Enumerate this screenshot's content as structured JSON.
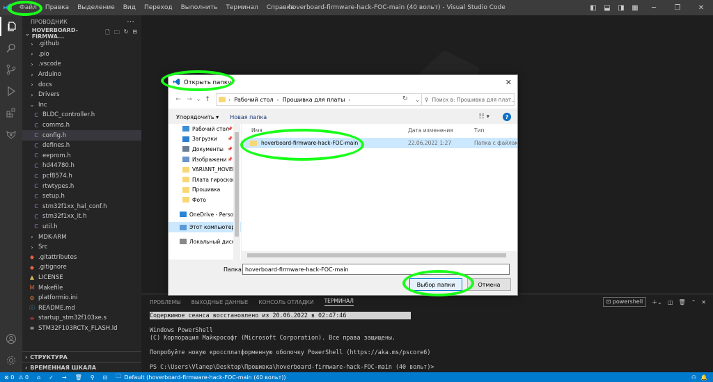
{
  "menu": {
    "items": [
      "Файл",
      "Правка",
      "Выделение",
      "Вид",
      "Переход",
      "Выполнить",
      "Терминал",
      "Справка"
    ]
  },
  "window_title": "hoverboard-firmware-hack-FOC-main (40 вольт) - Visual Studio Code",
  "sidebar": {
    "header": "ПРОВОДНИК",
    "folder": "HOVERBOARD-FIRMWA...",
    "tree": [
      {
        "label": ".github",
        "kind": "folder"
      },
      {
        "label": ".pio",
        "kind": "folder"
      },
      {
        "label": ".vscode",
        "kind": "folder"
      },
      {
        "label": "Arduino",
        "kind": "folder"
      },
      {
        "label": "docs",
        "kind": "folder"
      },
      {
        "label": "Drivers",
        "kind": "folder"
      },
      {
        "label": "Inc",
        "kind": "folder-open"
      },
      {
        "label": "BLDC_controller.h",
        "kind": "h"
      },
      {
        "label": "comms.h",
        "kind": "h"
      },
      {
        "label": "config.h",
        "kind": "h"
      },
      {
        "label": "defines.h",
        "kind": "h"
      },
      {
        "label": "eeprom.h",
        "kind": "h"
      },
      {
        "label": "hd44780.h",
        "kind": "h"
      },
      {
        "label": "pcf8574.h",
        "kind": "h"
      },
      {
        "label": "rtwtypes.h",
        "kind": "h"
      },
      {
        "label": "setup.h",
        "kind": "h"
      },
      {
        "label": "stm32f1xx_hal_conf.h",
        "kind": "h"
      },
      {
        "label": "stm32f1xx_it.h",
        "kind": "h"
      },
      {
        "label": "util.h",
        "kind": "h"
      },
      {
        "label": "MDK-ARM",
        "kind": "folder"
      },
      {
        "label": "Src",
        "kind": "folder"
      },
      {
        "label": ".gitattributes",
        "kind": "git"
      },
      {
        "label": ".gitignore",
        "kind": "git"
      },
      {
        "label": "LICENSE",
        "kind": "license"
      },
      {
        "label": "Makefile",
        "kind": "make"
      },
      {
        "label": "platformio.ini",
        "kind": "ini"
      },
      {
        "label": "README.md",
        "kind": "md"
      },
      {
        "label": "startup_stm32f103xe.s",
        "kind": "asm"
      },
      {
        "label": "STM32F103RCTx_FLASH.ld",
        "kind": "ld"
      }
    ],
    "sections": [
      "СТРУКТУРА",
      "ВРЕМЕННАЯ ШКАЛА"
    ]
  },
  "dialog": {
    "title": "Открыть папку",
    "breadcrumb": [
      "Рабочий стол",
      "Прошивка для платы"
    ],
    "search_placeholder": "Поиск в: Прошивка для плат...",
    "organize": "Упорядочить ▾",
    "new_folder": "Новая папка",
    "nav_items": [
      {
        "label": "Рабочий стол",
        "pin": "📌"
      },
      {
        "label": "Загрузки",
        "pin": "📌"
      },
      {
        "label": "Документы",
        "pin": "📌"
      },
      {
        "label": "Изображени",
        "pin": "📌"
      },
      {
        "label": "VARIANT_HOVER",
        "pin": ""
      },
      {
        "label": "Плата гироскоп",
        "pin": ""
      },
      {
        "label": "Прошивка",
        "pin": ""
      },
      {
        "label": "Фото",
        "pin": ""
      },
      {
        "label": "OneDrive - Person",
        "pin": ""
      },
      {
        "label": "Этот компьютер",
        "pin": ""
      },
      {
        "label": "Локальный диск",
        "pin": ""
      }
    ],
    "columns": {
      "name": "Имя",
      "date": "Дата изменения",
      "type": "Тип"
    },
    "file": {
      "name": "hoverboard-firmware-hack-FOC-main",
      "date": "22.06.2022 1:27",
      "type": "Папка с файлами"
    },
    "folder_label": "Папка:",
    "folder_value": "hoverboard-firmware-hack-FOC-main",
    "select_button": "Выбор папки",
    "cancel_button": "Отмена"
  },
  "panel": {
    "tabs": [
      "ПРОБЛЕМЫ",
      "ВЫХОДНЫЕ ДАННЫЕ",
      "КОНСОЛЬ ОТЛАДКИ",
      "ТЕРМИНАЛ"
    ],
    "shell": "powershell",
    "terminal": {
      "restore": "Содержимое сеанса восстановлено из 20.06.2022 в 02:47:46",
      "line1": "Windows PowerShell",
      "line2": "(C) Корпорация Майкрософт (Microsoft Corporation). Все права защищены.",
      "line3": "Попробуйте новую кроссплатформенную оболочку PowerShell (https://aka.ms/pscore6)",
      "prompt": "PS C:\\Users\\Vlanep\\Desktop\\Прошивка\\hoverboard-firmware-hack-FOC-main (40 вольт)>"
    }
  },
  "status": {
    "errors": "⊗ 0",
    "warnings": "⚠ 0",
    "env": "Default (hoverboard-firmware-hack-FOC-main (40 вольт))"
  },
  "colors": {
    "highlight": "#19ff19",
    "statusbar": "#007acc",
    "selection": "#cce8ff"
  }
}
